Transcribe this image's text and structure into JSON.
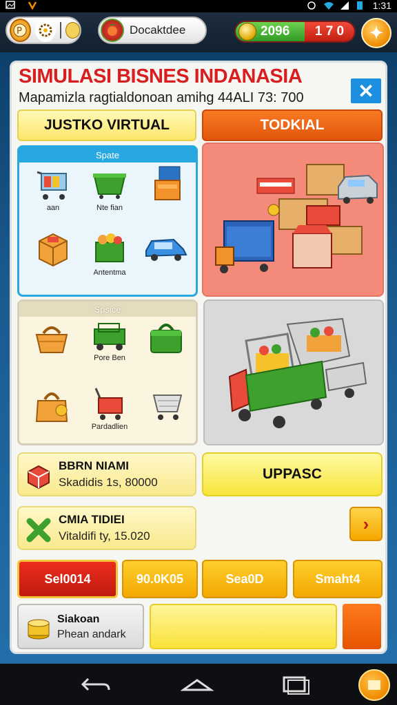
{
  "status": {
    "time": "1:31"
  },
  "topbar": {
    "search_label": "Docaktdee",
    "stat_value": "2096",
    "stat_right": "1 7 0"
  },
  "panel": {
    "title": "SIMULASI BISNES INDANASIA",
    "subtitle": "Mapamizla ragtialdonoan amihg 44ALI 73: 700",
    "close_icon": "close-icon",
    "tabs": [
      {
        "label": "JUSTKO VIRTUAL"
      },
      {
        "label": "TODKIAL"
      }
    ]
  },
  "card_a": {
    "header": "Spate",
    "items": [
      {
        "label": "aan",
        "icon": "shopping-cart-icon"
      },
      {
        "label": "Nte fian",
        "icon": "green-bin-icon"
      },
      {
        "label": "",
        "icon": "orange-stand-icon"
      },
      {
        "label": "",
        "icon": "orange-box-icon"
      },
      {
        "label": "Antentma",
        "icon": "produce-crate-icon"
      },
      {
        "label": "",
        "icon": "blue-car-icon"
      }
    ]
  },
  "card_c": {
    "header": "Spsice",
    "items": [
      {
        "label": "",
        "icon": "orange-basket-icon"
      },
      {
        "label": "Pore Ben",
        "icon": "green-truck-icon"
      },
      {
        "label": "",
        "icon": "green-bag-icon"
      },
      {
        "label": "",
        "icon": "orange-bag-icon"
      },
      {
        "label": "Pardadlien",
        "icon": "red-cart-icon"
      },
      {
        "label": "",
        "icon": "grey-cart-icon"
      }
    ]
  },
  "info_rows": [
    {
      "title": "BBRN NIAMI",
      "subtitle": "Skadidis 1s, 80000",
      "icon": "red-box-icon"
    },
    {
      "title": "CMIA TIDIEI",
      "subtitle": "Vitaldifi ty, 15.020",
      "icon": "green-x-icon"
    }
  ],
  "upgrade_label": "UPPASC",
  "arrow_icon": "chevron-right-icon",
  "segments": [
    {
      "label": "Sel0014"
    },
    {
      "label": "90.0K05"
    },
    {
      "label": "Sea0D"
    },
    {
      "label": "Smaht4"
    }
  ],
  "bottom_info": {
    "title": "Siakoan",
    "subtitle": "Phean andark",
    "icon": "coin-stack-icon"
  },
  "colors": {
    "accent_red": "#d81e1e",
    "tab_orange": "#e2560d",
    "close_blue": "#1d8fe0",
    "card_blue": "#27a8e0"
  }
}
